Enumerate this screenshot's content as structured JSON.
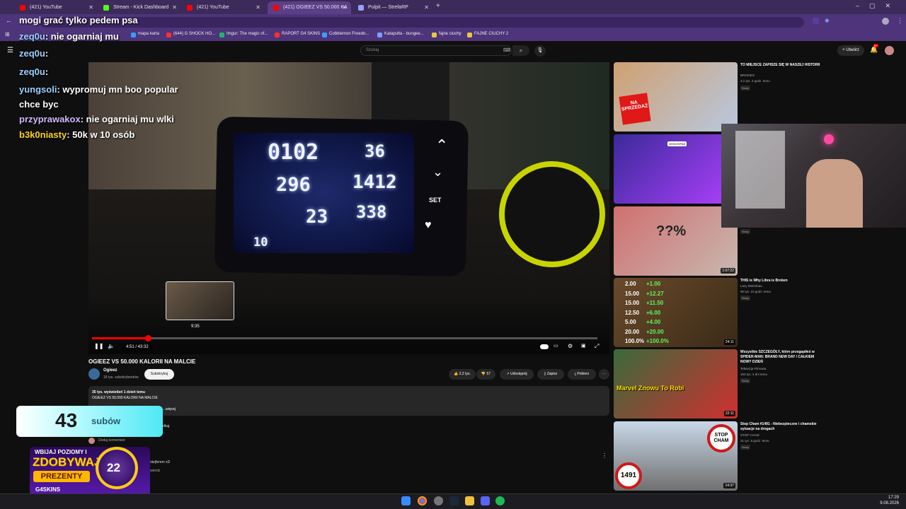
{
  "browser": {
    "tabs": [
      {
        "title": "(421) YouTube",
        "color": "#ff0000"
      },
      {
        "title": "Stream - Kick Dashboard",
        "color": "#53fc18"
      },
      {
        "title": "(421) YouTube",
        "color": "#ff0000"
      },
      {
        "title": "(421) OGIEEZ VS 50.000 KA",
        "color": "#ff0000"
      },
      {
        "title": "Pulpit — StrefaRP",
        "color": "#9aa0ff"
      }
    ],
    "new_tab": "+",
    "bookmarks": [
      {
        "label": "mapa karta",
        "color": "#3a9aff"
      },
      {
        "label": "(644) G SHOCK HO...",
        "color": "#ff3030"
      },
      {
        "label": "Imgur: The magic of...",
        "color": "#1bb76e"
      },
      {
        "label": "RAPORT G4 SKINS",
        "color": "#ff3030"
      },
      {
        "label": "Cobblemon Freedo...",
        "color": "#3aa0ff"
      },
      {
        "label": "Katapulta - bungee...",
        "color": "#7aa0ff"
      },
      {
        "label": "fajne ciuchy",
        "color": "#e8c840"
      },
      {
        "label": "FAJNE CIUCHY 2",
        "color": "#e8c840"
      }
    ]
  },
  "youtube": {
    "search_placeholder": "Szukaj",
    "create_label": "Utwórz",
    "notifications_badge": "9+"
  },
  "video": {
    "title": "OGIEEZ VS 50.000 KALORII NA MALCIE",
    "channel": "Ogieez",
    "channel_subs": "18 tys. subskrybentów",
    "subscribe_label": "Subskrybuj",
    "likes": "2,2 tys.",
    "dislikes": "57",
    "share_label": "Udostępnij",
    "save_label": "Zapisz",
    "download_label": "Pobierz",
    "views_line": "35 tys. wyświetleń  1 dzień temu",
    "desc_title": "OGIEEZ VS 50.000 KALORII NA MALCIE",
    "more_label": "...więcej",
    "time_current": "4:51",
    "time_total": "43:32",
    "time_display": "4:51 / 43:32",
    "hover_time": "9:35",
    "progress": 0.11,
    "hover": 0.22,
    "lcd": {
      "time": "0102",
      "distance": "36",
      "calories": "296",
      "pace": "1412",
      "spm": "23",
      "watts": "338",
      "level": "10",
      "set_label": "SET"
    }
  },
  "comments": {
    "add_comment": "Dodaj komentarz",
    "c1_tail": "omiejferem xD",
    "c1_sub": "powiedz",
    "chlebug": "dług"
  },
  "sidebar": [
    {
      "title": "TO MIEJSCE ZAPISZE SIĘ W NASZEJ HISTORII",
      "channel": "BROKIES",
      "meta": "3,1 tys.  2 godz. temu",
      "badge": "Nowy",
      "duration": "",
      "color1": "#d0a070",
      "color2": "#b8c8e0"
    },
    {
      "title": "",
      "channel": "",
      "meta": "",
      "badge": "",
      "duration": "",
      "color1": "#3a2a9a",
      "color2": "#b040ff"
    },
    {
      "title": "",
      "channel": "",
      "meta": "",
      "badge": "Nowy",
      "duration": "1:07:22",
      "color1": "#d07070",
      "color2": "#c8b8b0"
    },
    {
      "title": "THIS is Why Libra is Broken",
      "channel": "Lazy Marimbau",
      "meta": "96 tys.  10 godz. temu",
      "badge": "Nowy",
      "duration": "24:11",
      "color1": "#6a4a2a",
      "color2": "#3a2a18"
    },
    {
      "title": "Wszystkie SZCZEGÓŁY, które przegapiłeś w SPIDER-MAN: BRAND NEW DAY / CAŁKIEM NOWY DZIEŃ",
      "channel": "Telewizja Filmowa",
      "meta": "163 tys.  4 dni temu",
      "badge": "Nowy",
      "duration": "22:11",
      "color1": "#3a6a3a",
      "color2": "#d03030"
    },
    {
      "title": "Stop Cham #1491 - Niebezpieczne i chamskie sytuacje na drogach",
      "channel": "STOP CHAM",
      "meta": "31 tys.  8 godz. temu",
      "badge": "Nowy",
      "duration": "14:37",
      "color1": "#a8b8c8",
      "color2": "#707070"
    }
  ],
  "sidebar_text": {
    "thumb1_sign": "NA SPRZEDAŻ",
    "thumb2_cap": "WODOSPAD",
    "thumb3_text": "??%",
    "thumb5_caption": "Marvel Znowu To Robi",
    "thumb6_stop": "STOP CHAM",
    "thumb6_num": "1491",
    "libra_values": [
      "2.00",
      "15.00",
      "15.00",
      "12.50",
      "5.00",
      "20.00",
      "100.0%"
    ],
    "libra_bonus": [
      "+1.00",
      "+12.27",
      "+11.50",
      "+6.00",
      "+4.00",
      "+20.00",
      "+100.0%"
    ]
  },
  "chat": [
    {
      "user": "",
      "text": "mogi grać tylko pedem psa",
      "color": "#ffffff"
    },
    {
      "user": "zeq0u",
      "text": ": nie ogarniaj mu",
      "color": "#9ad0ff"
    },
    {
      "user": "zeq0u",
      "text": ":",
      "color": "#9ad0ff"
    },
    {
      "user": "zeq0u",
      "text": ":",
      "color": "#9ad0ff"
    },
    {
      "user": "yungsoli",
      "text": ": wypromuj mn boo popular",
      "color": "#9ad0ff"
    },
    {
      "user": "",
      "text": "chce byc",
      "color": "#ffffff"
    },
    {
      "user": "przyprawakox",
      "text": ": nie ogarniaj mu wlki",
      "color": "#d3b8ff"
    },
    {
      "user": "b3k0niasty",
      "text": ": 50k w 10 osób",
      "color": "#ffd21a"
    }
  ],
  "overlay": {
    "sub_count": "43",
    "sub_label": "subów",
    "promo_line1": "WBIJAJ POZIOMY I",
    "promo_line2": "ZDOBYWAJ",
    "promo_line3": "PREZENTY",
    "promo_brand": "G4SKINS",
    "medal_level": "22"
  },
  "taskbar": {
    "time": "17:29",
    "date": "9.08.2026"
  }
}
